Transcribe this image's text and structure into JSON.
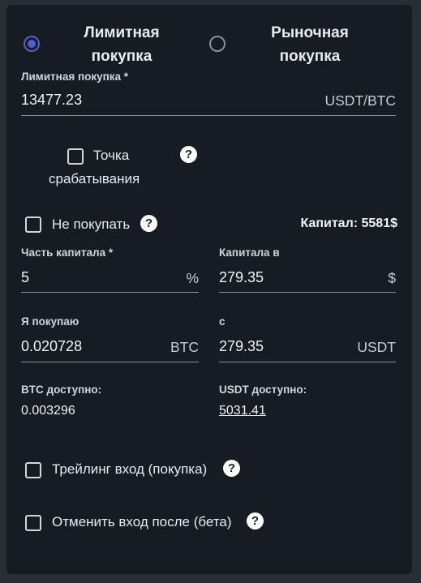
{
  "order_type": {
    "limit": {
      "label_line1": "Лимитная",
      "label_line2": "покупка",
      "selected": true
    },
    "market": {
      "label_line1": "Рыночная",
      "label_line2": "покупка",
      "selected": false
    }
  },
  "limit_price": {
    "label": "Лимитная покупка *",
    "value": "13477.23",
    "unit": "USDT/BTC"
  },
  "trigger_point": {
    "label_line1": "Точка",
    "label_line2": "срабатывания",
    "checked": false
  },
  "dont_buy": {
    "label": "Не покупать",
    "checked": false
  },
  "capital": {
    "label": "Капитал: 5581$"
  },
  "capital_part": {
    "label": "Часть капитала *",
    "value": "5",
    "unit": "%"
  },
  "capital_in": {
    "label": "Капитала в",
    "value": "279.35",
    "unit": "$"
  },
  "i_buy": {
    "label": "Я покупаю",
    "value": "0.020728",
    "unit": "BTC"
  },
  "with": {
    "label": "с",
    "value": "279.35",
    "unit": "USDT"
  },
  "btc_available": {
    "label": "BTC доступно:",
    "value": "0.003296"
  },
  "usdt_available": {
    "label": "USDT доступно:",
    "value": "5031.41"
  },
  "trailing_entry": {
    "label": "Трейлинг вход (покупка)",
    "checked": false
  },
  "cancel_entry": {
    "label": "Отменить вход после (бета)",
    "checked": false
  },
  "help_glyph": "?",
  "colors": {
    "accent": "#4e5fd6",
    "panel_bg": "#171b23",
    "page_bg": "#2a2d34"
  }
}
